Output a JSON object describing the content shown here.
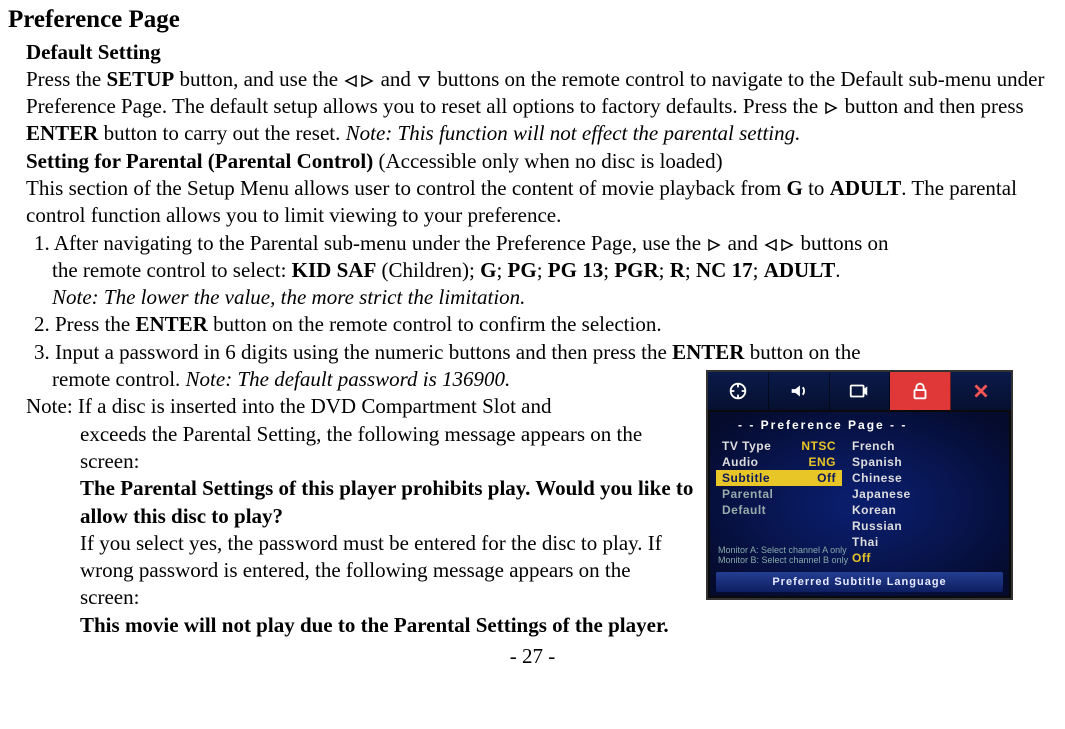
{
  "title": "Preference Page",
  "default_heading": "Default Setting",
  "p_default_1a": "Press the ",
  "p_default_1b": "SETUP",
  "p_default_1c": " button, and use the ",
  "p_default_1d": " and ",
  "p_default_1e": " buttons on the remote control to navigate to the Default sub-menu under Preference Page. The default setup allows you to reset all options to factory defaults. Press the ",
  "p_default_1f": " button and then press ",
  "p_default_1g": "ENTER",
  "p_default_1h": " button to carry out the reset. ",
  "p_default_note": "Note: This function will not effect the parental setting.",
  "parental_heading": "Setting for Parental (Parental Control)",
  "parental_heading_suffix": " (Accessible only when no disc is loaded)",
  "parental_intro_a": "This section of the Setup Menu allows user to control the content of movie playback from ",
  "parental_intro_b": "G",
  "parental_intro_c": " to ",
  "parental_intro_d": "ADULT",
  "parental_intro_e": ". The parental control function allows you to limit viewing to your preference.",
  "li1_a": "1. After navigating to the Parental sub-menu under the Preference Page, use the ",
  "li1_b": " and ",
  "li1_c": " buttons on",
  "li1_body_a": "the remote control to select: ",
  "li1_body_b": "KID SAF",
  "li1_body_c": " (Children); ",
  "li1_body_d": "G",
  "li1_body_e": "; ",
  "li1_body_f": "PG",
  "li1_body_g": "; ",
  "li1_body_h": "PG 13",
  "li1_body_i": "; ",
  "li1_body_j": "PGR",
  "li1_body_k": "; ",
  "li1_body_l": "R",
  "li1_body_m": "; ",
  "li1_body_n": "NC 17",
  "li1_body_o": "; ",
  "li1_body_p": "ADULT",
  "li1_body_q": ".",
  "li1_note": "Note: The lower the value, the more strict the limitation.",
  "li2_a": "2. Press the ",
  "li2_b": "ENTER",
  "li2_c": " button on the remote control to confirm the selection.",
  "li3_a": "3. Input a password in 6 digits using the numeric buttons and then press the ",
  "li3_b": "ENTER",
  "li3_c": " button on the",
  "li3_body_a": "remote control. ",
  "li3_note": "Note: The default password is 136900.",
  "note_head": "Note: If a disc is inserted into the DVD Compartment Slot and",
  "note_l2": "exceeds the Parental Setting, the following message appears on the screen:",
  "note_bold1": "The Parental Settings of this player prohibits play. Would you like to allow this disc to play?",
  "note_l3": "If you select yes, the password must be entered for the disc to play. If wrong password is entered, the following message appears on the screen:",
  "note_bold2": "This movie will not play due to the Parental Settings of the player.",
  "page_number": "- 27 -",
  "osd": {
    "title": "- -  Preference  Page  - -",
    "left": [
      {
        "label": "TV Type",
        "value": "NTSC",
        "cls": ""
      },
      {
        "label": "Audio",
        "value": "ENG",
        "cls": ""
      },
      {
        "label": "Subtitle",
        "value": "Off",
        "cls": "hl"
      },
      {
        "label": "Parental",
        "value": "",
        "cls": "grey"
      },
      {
        "label": "Default",
        "value": "",
        "cls": "grey"
      }
    ],
    "right": [
      {
        "label": "French",
        "cls": ""
      },
      {
        "label": "Spanish",
        "cls": ""
      },
      {
        "label": "Chinese",
        "cls": ""
      },
      {
        "label": "Japanese",
        "cls": ""
      },
      {
        "label": "Korean",
        "cls": ""
      },
      {
        "label": "Russian",
        "cls": ""
      },
      {
        "label": "Thai",
        "cls": ""
      },
      {
        "label": "Off",
        "cls": "off"
      }
    ],
    "note1": "Monitor A: Select channel A only",
    "note2": "Monitor B: Select channel B only",
    "bottom": "Preferred Subtitle Language"
  }
}
